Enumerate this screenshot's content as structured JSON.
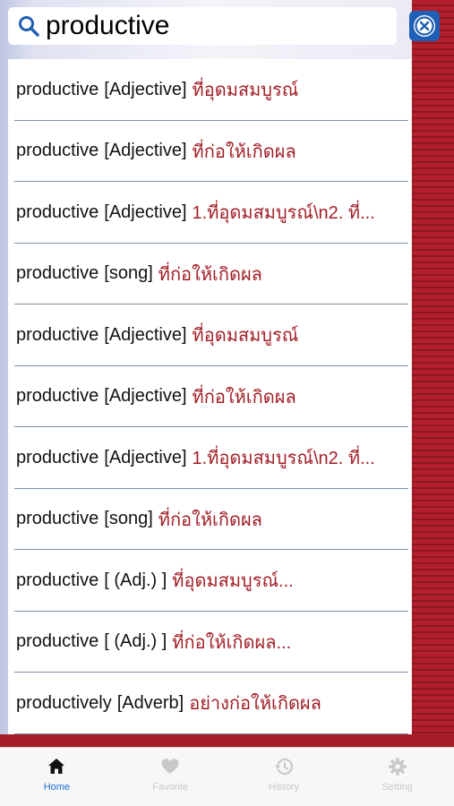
{
  "search": {
    "value": "productive",
    "icon": "search-icon",
    "clear_icon": "clear-icon"
  },
  "results": [
    {
      "word": "productive",
      "pos": "[Adjective]",
      "translation": "ที่อุดมสมบูรณ์"
    },
    {
      "word": "productive",
      "pos": "[Adjective]",
      "translation": "ที่ก่อให้เกิดผล"
    },
    {
      "word": "productive",
      "pos": "[Adjective]",
      "translation": "1.ที่อุดมสมบูรณ์\\n2. ที่..."
    },
    {
      "word": "productive",
      "pos": "[song]",
      "translation": "ที่ก่อให้เกิดผล"
    },
    {
      "word": "productive",
      "pos": "[Adjective]",
      "translation": "ที่อุดมสมบูรณ์"
    },
    {
      "word": "productive",
      "pos": "[Adjective]",
      "translation": "ที่ก่อให้เกิดผล"
    },
    {
      "word": "productive",
      "pos": "[Adjective]",
      "translation": "1.ที่อุดมสมบูรณ์\\n2. ที่..."
    },
    {
      "word": "productive",
      "pos": "[song]",
      "translation": "ที่ก่อให้เกิดผล"
    },
    {
      "word": "productive",
      "pos": "[ (Adj.) ]",
      "translation": "ที่อุดมสมบูรณ์..."
    },
    {
      "word": "productive",
      "pos": "[ (Adj.) ]",
      "translation": "ที่ก่อให้เกิดผล..."
    },
    {
      "word": "productively",
      "pos": "[Adverb]",
      "translation": "อย่างก่อให้เกิดผล"
    }
  ],
  "tabs": [
    {
      "label": "Home",
      "icon": "home-icon",
      "active": true
    },
    {
      "label": "Favorite",
      "icon": "heart-icon",
      "active": false
    },
    {
      "label": "History",
      "icon": "history-icon",
      "active": false
    },
    {
      "label": "Setting",
      "icon": "gear-icon",
      "active": false
    }
  ],
  "colors": {
    "accent": "#1a6fd6",
    "translation": "#a21e26",
    "side_red": "#b1202a",
    "clear_button": "#1f5fb5"
  }
}
